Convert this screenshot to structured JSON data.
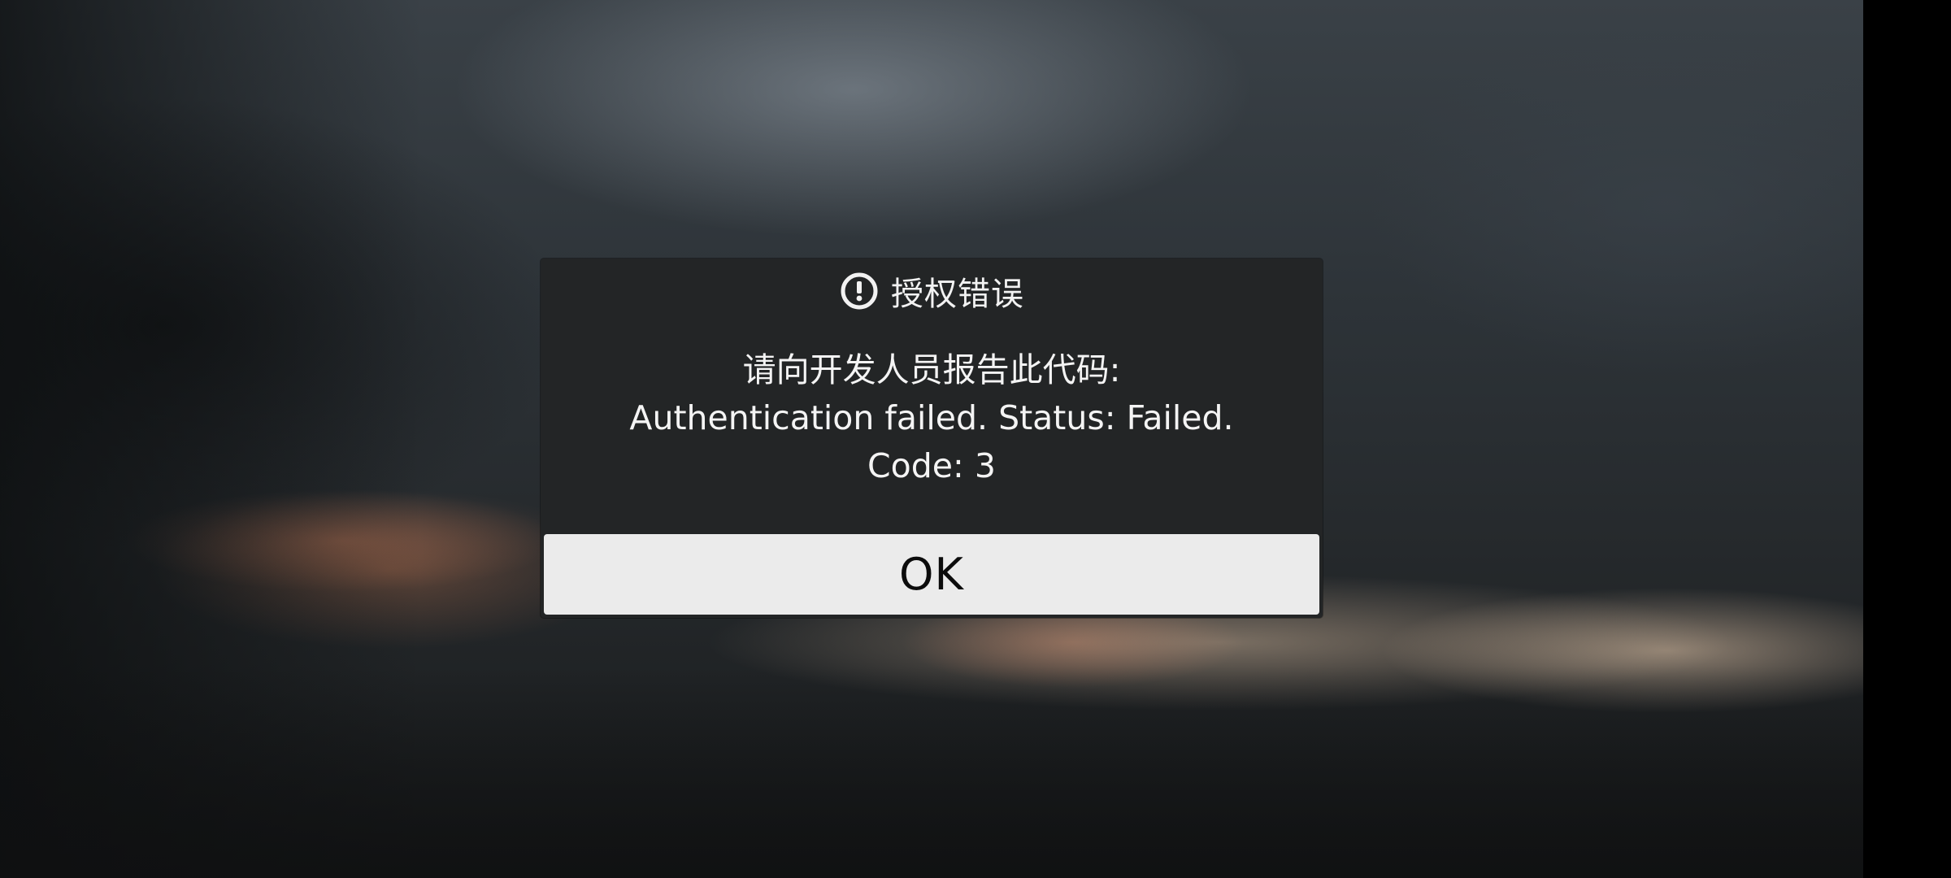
{
  "dialog": {
    "icon": "alert-circle-icon",
    "title": "授权错误",
    "message_lines": [
      "请向开发人员报告此代码:",
      "Authentication failed. Status: Failed.",
      "Code: 3"
    ],
    "ok_label": "OK"
  },
  "colors": {
    "dialog_background": "#232526",
    "button_background": "#ebebeb",
    "text_light": "#f4f4f4",
    "text_dark": "#0c0c0c"
  }
}
